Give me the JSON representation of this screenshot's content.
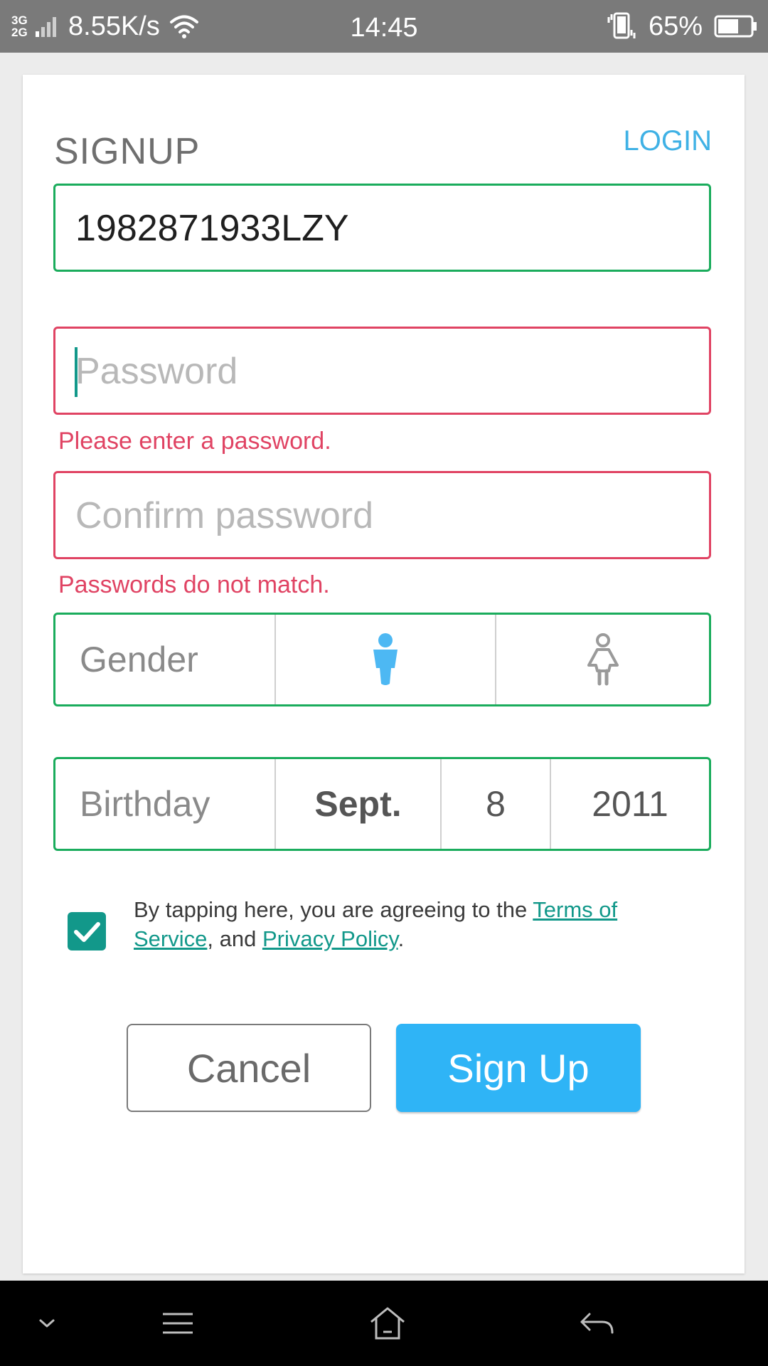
{
  "status_bar": {
    "network_type_top": "3G",
    "network_type_bottom": "2G",
    "net_speed": "8.55K/s",
    "time": "14:45",
    "battery": "65%",
    "icons": [
      "signal-icon",
      "wifi-icon",
      "vibrate-icon",
      "battery-icon"
    ]
  },
  "header": {
    "title": "SIGNUP",
    "login_link": "LOGIN"
  },
  "form": {
    "username": {
      "value": "1982871933LZY"
    },
    "password": {
      "placeholder": "Password",
      "error": "Please enter a password."
    },
    "confirm_password": {
      "placeholder": "Confirm password",
      "error": "Passwords do not match."
    },
    "gender": {
      "label": "Gender",
      "options": [
        "male-icon",
        "female-icon"
      ],
      "selected": "male"
    },
    "birthday": {
      "label": "Birthday",
      "month": "Sept.",
      "day": "8",
      "year": "2011"
    },
    "terms": {
      "checked": true,
      "text_before": "By tapping here, you are agreeing to the ",
      "terms_link": "Terms of Service",
      "text_middle": ", and ",
      "privacy_link": "Privacy Policy",
      "text_after": "."
    }
  },
  "buttons": {
    "cancel": "Cancel",
    "signup": "Sign Up"
  },
  "nav_bar": {
    "icons": [
      "chevron-down-icon",
      "menu-icon",
      "home-icon",
      "back-icon"
    ]
  },
  "colors": {
    "valid_border": "#1aac5c",
    "error": "#e04363",
    "accent_teal": "#12988a",
    "primary_blue": "#2fb4f6",
    "link_blue": "#3fb1e5",
    "status_bar": "#7a7a7a"
  }
}
